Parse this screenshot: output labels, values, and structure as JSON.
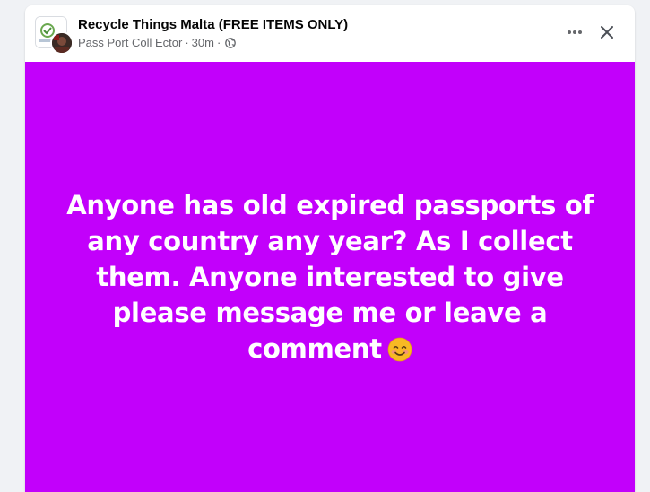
{
  "post": {
    "group_name": "Recycle Things Malta (FREE ITEMS ONLY)",
    "author": "Pass Port Coll Ector",
    "separator": "·",
    "time": "30m",
    "privacy_icon": "globe-icon",
    "body_text": "Anyone has old expired passports of any country any year? As I collect them. Anyone interested to give please message me or leave a comment",
    "emoji": "smiling-face-emoji",
    "background_color": "#c200fb",
    "text_color": "#ffffff"
  },
  "actions": {
    "more_icon": "more-options-icon",
    "close_icon": "close-icon"
  }
}
